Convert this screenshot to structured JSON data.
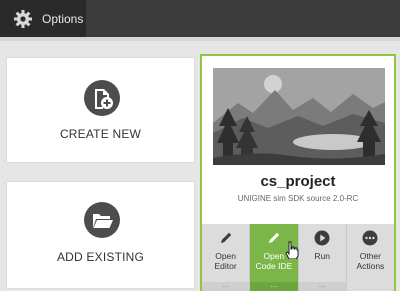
{
  "topbar": {
    "options_label": "Options"
  },
  "cards": {
    "create_new_label": "CREATE NEW",
    "add_existing_label": "ADD EXISTING"
  },
  "project": {
    "name": "cs_project",
    "description": "UNIGINE sim SDK source 2.0-RC",
    "actions": [
      {
        "label": "Open\nEditor",
        "icon": "pencil-icon",
        "more": "...",
        "active": false
      },
      {
        "label": "Open\nCode IDE",
        "icon": "pencil-icon",
        "more": "...",
        "active": true
      },
      {
        "label": "Run",
        "icon": "play-icon",
        "more": "...",
        "active": false
      },
      {
        "label": "Other\nActions",
        "icon": "more-icon",
        "more": "",
        "active": false
      }
    ]
  },
  "colors": {
    "accent_green": "#8dc63f",
    "active_action": "#7ab648",
    "topbar": "#3b3b3b"
  }
}
